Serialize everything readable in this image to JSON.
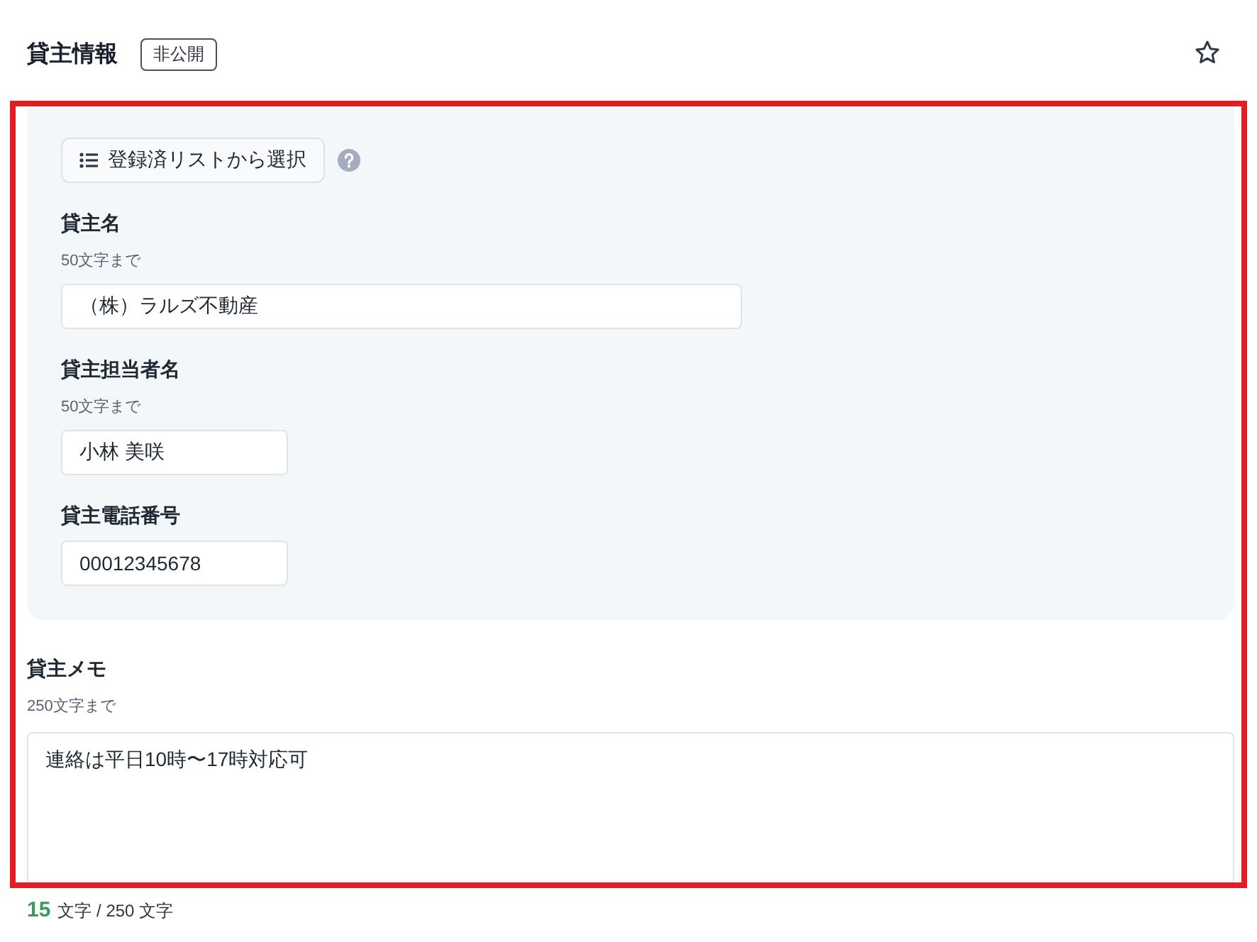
{
  "header": {
    "title": "貸主情報",
    "badge": "非公開",
    "starred": false
  },
  "picker": {
    "button": "登録済リストから選択"
  },
  "fields": [
    {
      "kind": "wide",
      "label": "貸主名",
      "hint": "50文字まで",
      "value": "（株）ラルズ不動産"
    },
    {
      "kind": "short",
      "label": "貸主担当者名",
      "hint": "50文字まで",
      "value": "小林 美咲"
    },
    {
      "kind": "short",
      "label": "貸主電話番号",
      "value": "00012345678"
    }
  ],
  "memo": {
    "label": "貸主メモ",
    "hint": "250文字まで",
    "value": "連絡は平日10時〜17時対応可",
    "count": "15",
    "limit": "文字 / 250 文字"
  }
}
